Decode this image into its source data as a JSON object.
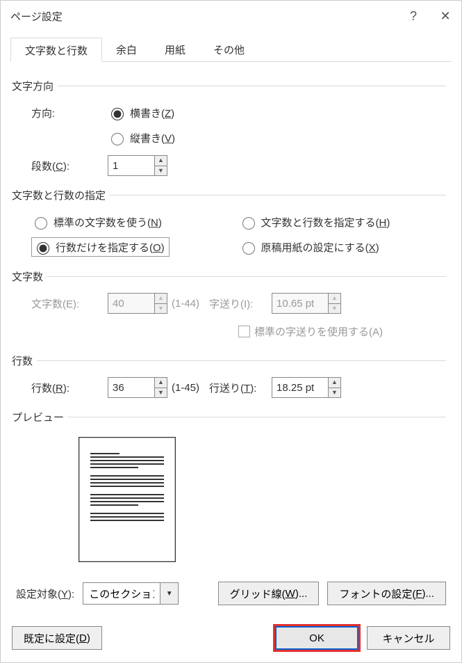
{
  "title": "ページ設定",
  "tabs": [
    "文字数と行数",
    "余白",
    "用紙",
    "その他"
  ],
  "direction": {
    "legend": "文字方向",
    "label": "方向:",
    "horizontal_pre": "横書き(",
    "horizontal_u": "Z",
    "horizontal_post": ")",
    "vertical_pre": "縦書き(",
    "vertical_u": "V",
    "vertical_post": ")",
    "columns_pre": "段数(",
    "columns_u": "C",
    "columns_post": "):",
    "columns_value": "1"
  },
  "spec": {
    "legend": "文字数と行数の指定",
    "std_pre": "標準の文字数を使う(",
    "std_u": "N",
    "std_post": ")",
    "both_pre": "文字数と行数を指定する(",
    "both_u": "H",
    "both_post": ")",
    "lines_pre": "行数だけを指定する(",
    "lines_u": "O",
    "lines_post": ")",
    "genkou_pre": "原稿用紙の設定にする(",
    "genkou_u": "X",
    "genkou_post": ")"
  },
  "chars": {
    "legend": "文字数",
    "count_label": "文字数(E):",
    "count_value": "40",
    "count_range": "(1-44)",
    "pitch_label": "字送り(I):",
    "pitch_value": "10.65 pt",
    "std_pitch": "標準の字送りを使用する(A)"
  },
  "lines": {
    "legend": "行数",
    "count_pre": "行数(",
    "count_u": "R",
    "count_post": "):",
    "count_value": "36",
    "count_range": "(1-45)",
    "pitch_pre": "行送り(",
    "pitch_u": "T",
    "pitch_post": "):",
    "pitch_value": "18.25 pt"
  },
  "preview": {
    "legend": "プレビュー"
  },
  "apply": {
    "label_pre": "設定対象(",
    "label_u": "Y",
    "label_post": "):",
    "value": "このセクション",
    "grid_pre": "グリッド線(",
    "grid_u": "W",
    "grid_post": ")...",
    "font_pre": "フォントの設定(",
    "font_u": "F",
    "font_post": ")..."
  },
  "footer": {
    "default_pre": "既定に設定(",
    "default_u": "D",
    "default_post": ")",
    "ok": "OK",
    "cancel": "キャンセル"
  }
}
